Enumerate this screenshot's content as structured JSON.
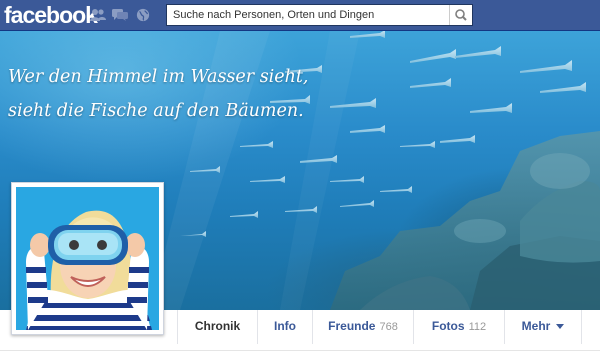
{
  "header": {
    "logo_text": "facebook",
    "search_placeholder": "Suche nach Personen, Orten und Dingen",
    "jewels": [
      "friend-requests-icon",
      "messages-icon",
      "notifications-globe-icon"
    ],
    "brand_color": "#3b5998"
  },
  "cover": {
    "quote_line1": "Wer den Himmel im Wasser sieht,",
    "quote_line2": "sieht die Fische auf den Bäumen."
  },
  "nav": {
    "tabs": [
      {
        "label": "Chronik",
        "count": ""
      },
      {
        "label": "Info",
        "count": ""
      },
      {
        "label": "Freunde",
        "count": "768"
      },
      {
        "label": "Fotos",
        "count": "112"
      },
      {
        "label": "Mehr",
        "count": ""
      }
    ],
    "active_tab": "Chronik"
  }
}
